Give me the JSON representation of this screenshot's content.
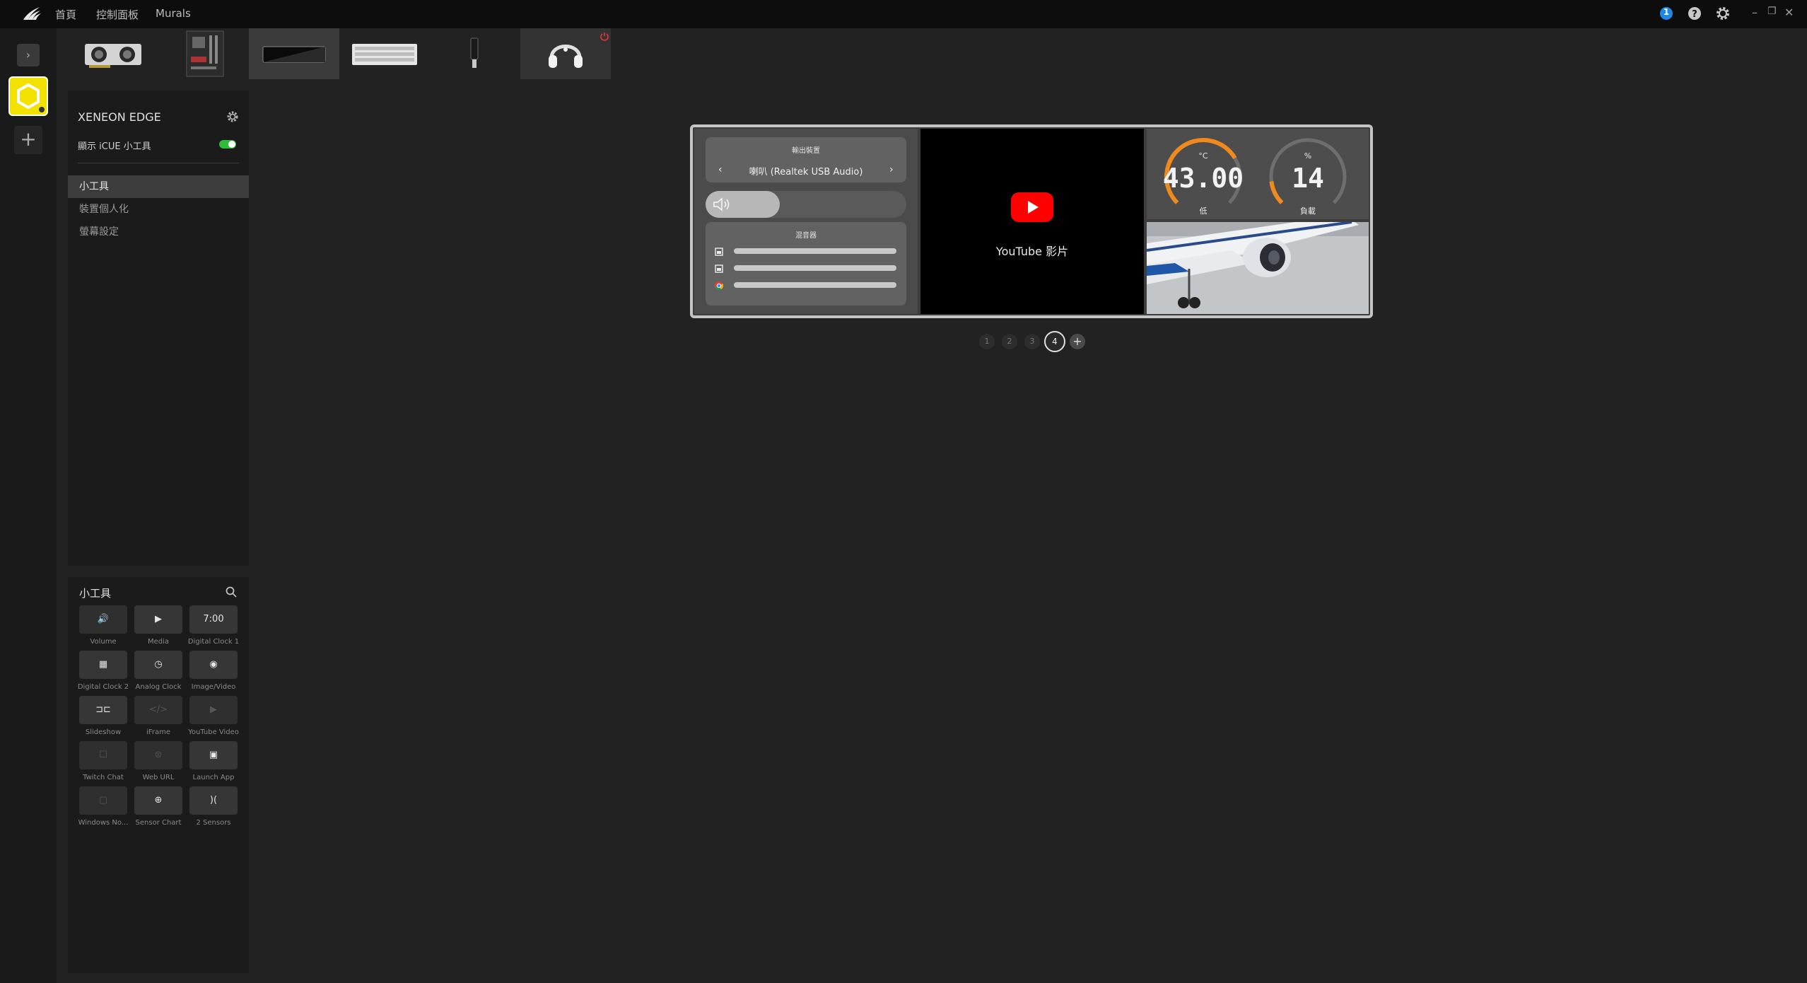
{
  "nav": {
    "home": "首頁",
    "dashboard": "控制面板",
    "murals": "Murals"
  },
  "titlebar": {
    "notification_count": "1"
  },
  "devices": [
    {
      "name": "gpu",
      "selected": false
    },
    {
      "name": "motherboard",
      "selected": false
    },
    {
      "name": "xeneon-edge-display",
      "selected": true
    },
    {
      "name": "keyboard",
      "selected": false
    },
    {
      "name": "usb-receiver",
      "selected": false
    },
    {
      "name": "headset",
      "selected": false
    }
  ],
  "panel": {
    "device_title": "XENEON EDGE",
    "toggle_label": "顯示 iCUE 小工具",
    "toggle_on": true,
    "menu": [
      {
        "label": "小工具",
        "active": true
      },
      {
        "label": "裝置個人化",
        "active": false
      },
      {
        "label": "螢幕設定",
        "active": false
      }
    ]
  },
  "library": {
    "title": "小工具",
    "widgets": [
      {
        "label": "Volume",
        "icon": "volume-icon",
        "glyph": "🔊",
        "enabled": false
      },
      {
        "label": "Media",
        "icon": "media-play-icon",
        "glyph": "▶",
        "enabled": true
      },
      {
        "label": "Digital Clock 1",
        "icon": "digital-clock-icon",
        "glyph": "7:00",
        "enabled": true
      },
      {
        "label": "Digital Clock 2",
        "icon": "digital-clock-2-icon",
        "glyph": "▦",
        "enabled": true
      },
      {
        "label": "Analog Clock",
        "icon": "analog-clock-icon",
        "glyph": "◷",
        "enabled": true
      },
      {
        "label": "Image/Video",
        "icon": "image-video-icon",
        "glyph": "◉",
        "enabled": true
      },
      {
        "label": "Slideshow",
        "icon": "slideshow-icon",
        "glyph": "⊐⊏",
        "enabled": true
      },
      {
        "label": "iFrame",
        "icon": "iframe-icon",
        "glyph": "</>",
        "enabled": false
      },
      {
        "label": "YouTube Video",
        "icon": "youtube-icon",
        "glyph": "▶",
        "enabled": false
      },
      {
        "label": "Twitch Chat",
        "icon": "twitch-chat-icon",
        "glyph": "☐",
        "enabled": false
      },
      {
        "label": "Web URL",
        "icon": "web-url-icon",
        "glyph": "⊜",
        "enabled": false
      },
      {
        "label": "Launch App",
        "icon": "launch-app-icon",
        "glyph": "▣",
        "enabled": true
      },
      {
        "label": "Windows No...",
        "icon": "windows-notification-icon",
        "glyph": "▢",
        "enabled": false
      },
      {
        "label": "Sensor Chart",
        "icon": "sensor-chart-icon",
        "glyph": "⊕",
        "enabled": true
      },
      {
        "label": "2 Sensors",
        "icon": "two-sensors-icon",
        "glyph": ")(",
        "enabled": true
      }
    ]
  },
  "preview": {
    "audio": {
      "output_caption": "輸出裝置",
      "output_device": "喇叭 (Realtek USB Audio)",
      "volume_level": 0.37,
      "mixer_caption": "混音器",
      "mixer_apps": [
        "app-1",
        "app-2",
        "chrome"
      ]
    },
    "video": {
      "caption": "YouTube 影片"
    },
    "sensors": [
      {
        "unit": "°C",
        "value": "43.00",
        "label": "低",
        "fraction": 0.72,
        "color": "#f08a1c"
      },
      {
        "unit": "%",
        "value": "14",
        "label": "負載",
        "fraction": 0.14,
        "color": "#f08a1c"
      }
    ]
  },
  "pagination": {
    "pages": [
      "1",
      "2",
      "3",
      "4"
    ],
    "active": "4"
  },
  "colors": {
    "accent_yellow": "#f3e200",
    "toggle_green": "#2fbb3a",
    "gauge_orange": "#f08a1c",
    "notify_blue": "#1e88e5",
    "youtube_red": "#ff0000"
  }
}
